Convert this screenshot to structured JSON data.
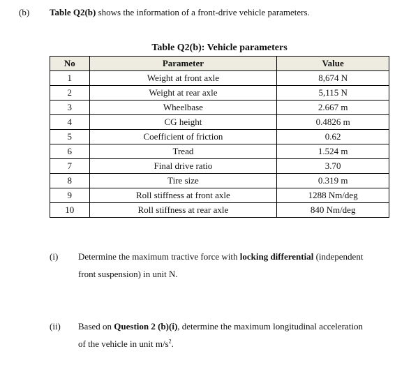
{
  "part_b": {
    "label": "(b)",
    "intro_bold": "Table Q2(b)",
    "intro_rest": " shows the information of a front-drive vehicle parameters."
  },
  "table": {
    "caption": "Table Q2(b): Vehicle parameters",
    "headers": {
      "no": "No",
      "parameter": "Parameter",
      "value": "Value"
    },
    "rows": [
      {
        "no": "1",
        "parameter": "Weight at front axle",
        "value": "8,674 N"
      },
      {
        "no": "2",
        "parameter": "Weight at rear axle",
        "value": "5,115 N"
      },
      {
        "no": "3",
        "parameter": "Wheelbase",
        "value": "2.667 m"
      },
      {
        "no": "4",
        "parameter": "CG height",
        "value": "0.4826 m"
      },
      {
        "no": "5",
        "parameter": "Coefficient of friction",
        "value": "0.62"
      },
      {
        "no": "6",
        "parameter": "Tread",
        "value": "1.524 m"
      },
      {
        "no": "7",
        "parameter": "Final drive ratio",
        "value": "3.70"
      },
      {
        "no": "8",
        "parameter": "Tire size",
        "value": "0.319 m"
      },
      {
        "no": "9",
        "parameter": "Roll stiffness at front axle",
        "value": "1288 Nm/deg"
      },
      {
        "no": "10",
        "parameter": "Roll stiffness at rear axle",
        "value": "840 Nm/deg"
      }
    ]
  },
  "question_i": {
    "label": "(i)",
    "line1_pre": "Determine the maximum tractive force with ",
    "line1_bold": "locking differential",
    "line1_post": " (independent",
    "line2": "front suspension) in unit N."
  },
  "question_ii": {
    "label": "(ii)",
    "line1_pre": "Based on ",
    "line1_bold": "Question 2 (b)(i)",
    "line1_post": ", determine the maximum longitudinal acceleration",
    "line2_pre": "of the vehicle in unit m/s",
    "line2_sup": "2",
    "line2_post": "."
  }
}
